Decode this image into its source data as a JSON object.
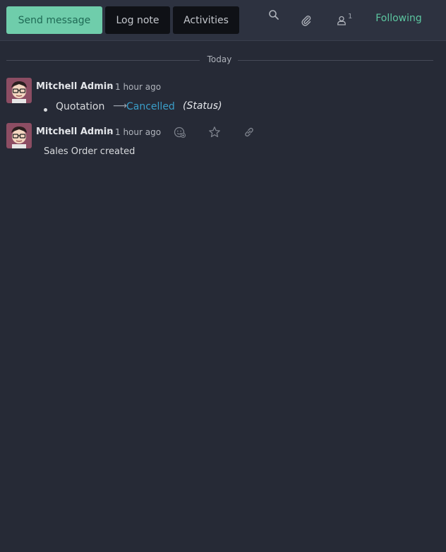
{
  "toolbar": {
    "send_label": "Send message",
    "log_label": "Log note",
    "activities_label": "Activities",
    "follower_count": "1",
    "following_label": "Following",
    "icons": [
      "search-icon",
      "paperclip-icon",
      "user-icon"
    ]
  },
  "thread": {
    "date_separator": "Today",
    "messages": [
      {
        "author": "Mitchell Admin",
        "separator": "-",
        "date": "1 hour ago",
        "tracking": {
          "old_value": "Quotation",
          "new_value": "Cancelled",
          "field": "(Status)"
        }
      },
      {
        "author": "Mitchell Admin",
        "separator": "-",
        "date": "1 hour ago",
        "body": "Sales Order created",
        "actions": [
          "add-reaction-icon",
          "star-icon",
          "link-icon"
        ]
      }
    ]
  },
  "colors": {
    "accent": "#6fcdab",
    "link": "#3a9ec9",
    "background": "#262a36"
  }
}
